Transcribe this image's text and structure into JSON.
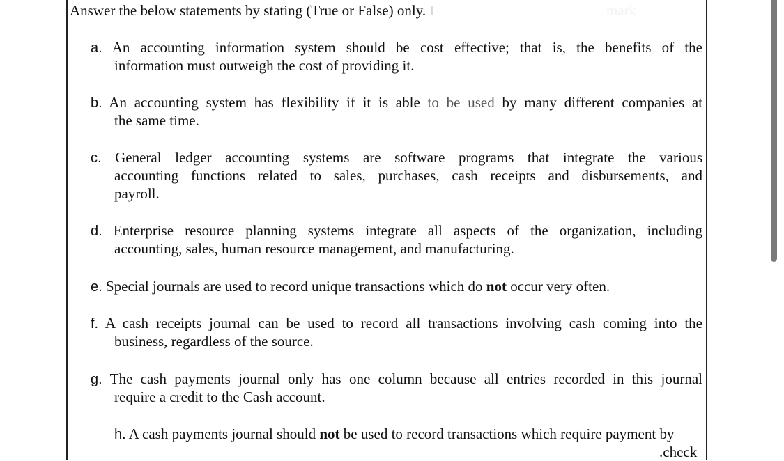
{
  "header": {
    "instruction": "Answer the below statements by stating (True or False) only.",
    "faded_char": "I",
    "ghost_text": "mark"
  },
  "items": [
    {
      "label": "a.",
      "line1": "An accounting information system should be cost effective; that is, the benefits of the",
      "line2": "information must outweigh the cost of providing it."
    },
    {
      "label": "b.",
      "line1a": "An accounting system has flexibility if it is able",
      "line1b": "to be used",
      "line1c": "by many different companies at",
      "line2": "the same time."
    },
    {
      "label": "c.",
      "line1": "General ledger accounting systems are software programs that integrate the various",
      "line2": "accounting functions related to sales, purchases, cash receipts and disbursements, and",
      "line3": "payroll."
    },
    {
      "label": "d.",
      "line1": "Enterprise resource planning systems integrate all aspects of the organization, including",
      "line2": "accounting, sales, human resource management, and manufacturing."
    },
    {
      "label": "e.",
      "pre": "Special journals are used to record unique transactions which do",
      "bold": "not",
      "post": "occur very often."
    },
    {
      "label": "f.",
      "line1": "A cash receipts journal can be used to record all transactions involving cash coming into the",
      "line2": "business, regardless of the source."
    },
    {
      "label": "g.",
      "line1": "The cash payments journal only has one column because all entries recorded in this journal",
      "line2": "require a credit to the Cash account."
    },
    {
      "label": "h.",
      "pre": "A cash payments journal should",
      "bold": "not",
      "post": "be used to record transactions which require payment by",
      "line2": ".check"
    }
  ]
}
